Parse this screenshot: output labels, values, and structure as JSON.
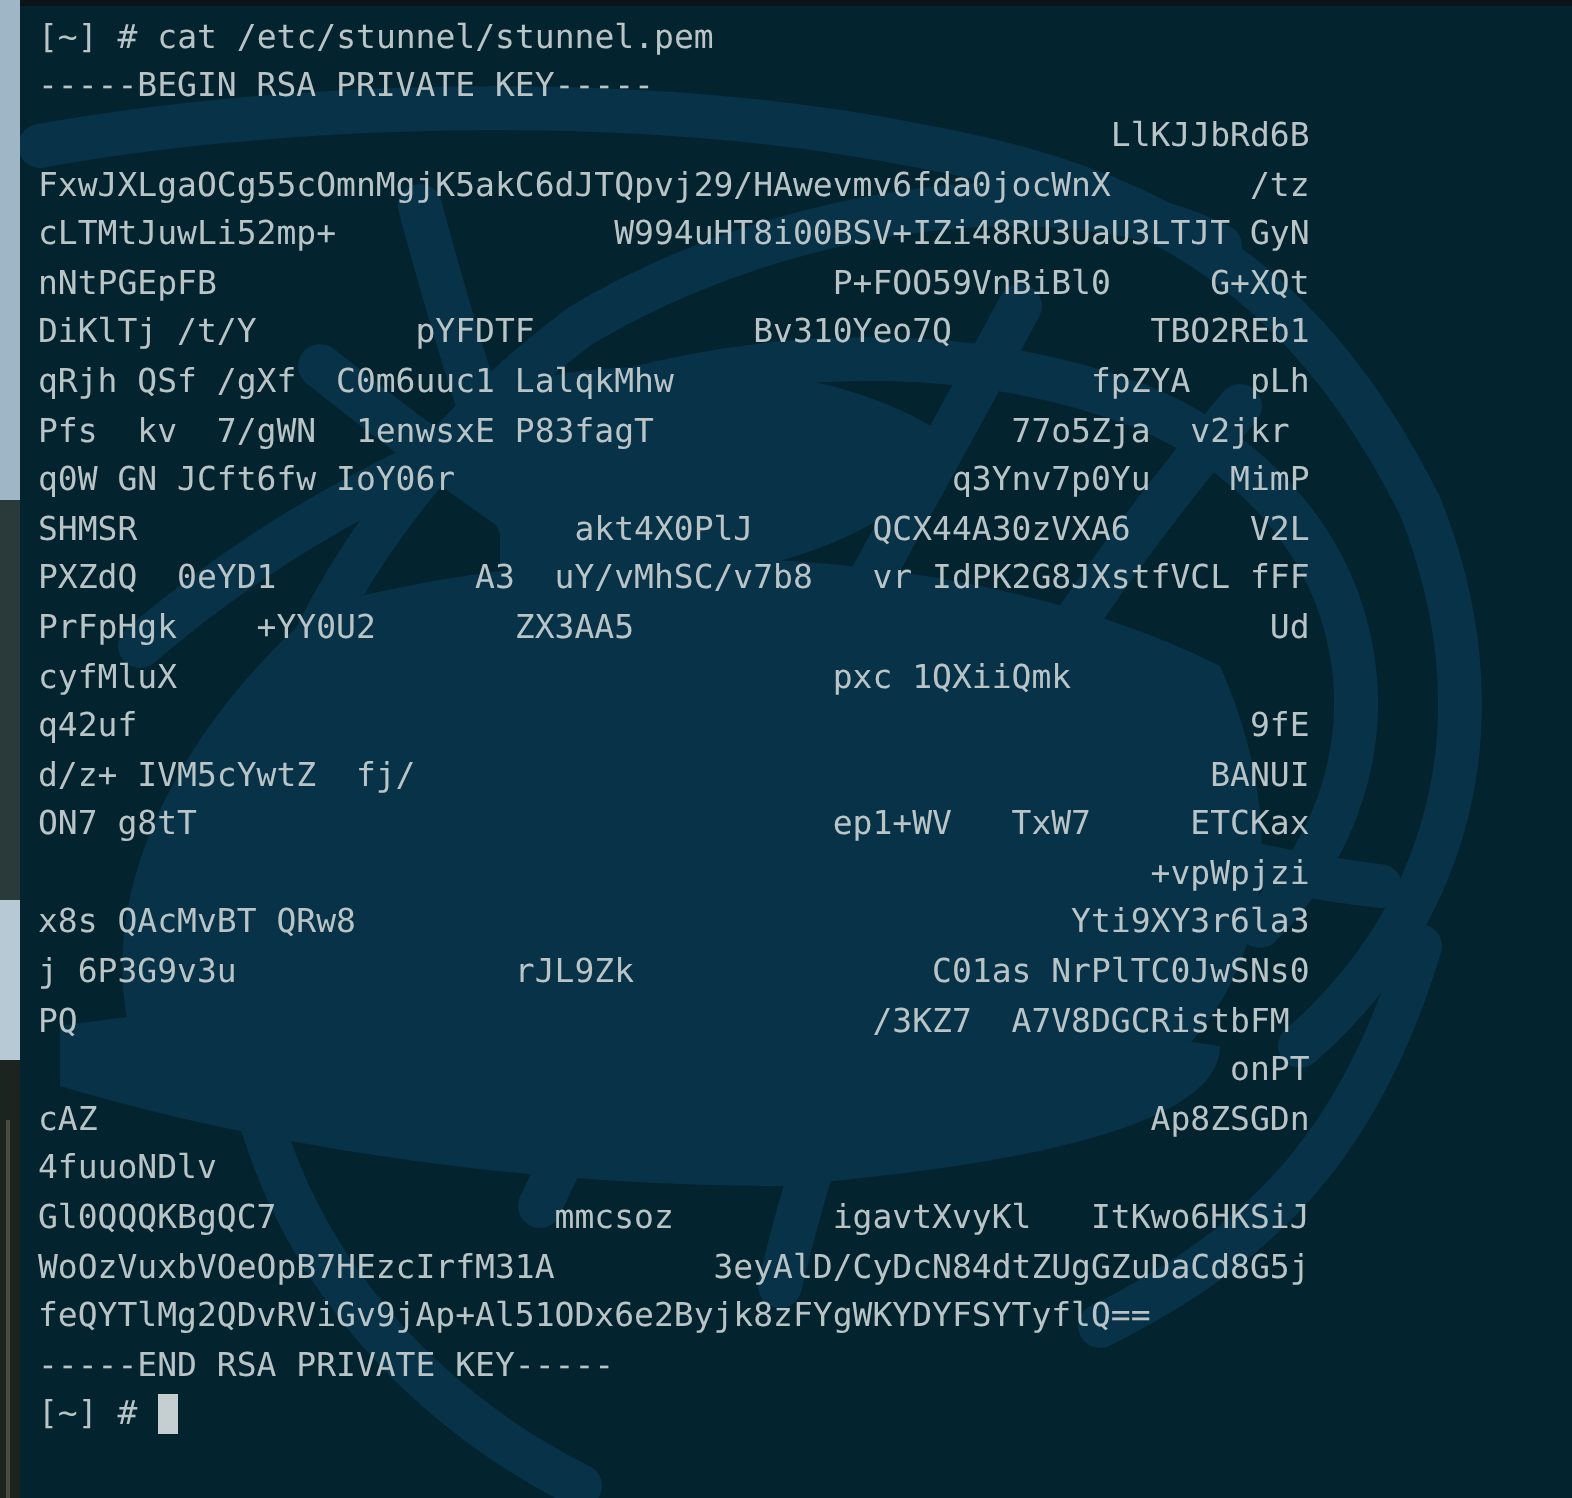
{
  "terminal": {
    "lines": [
      {
        "kind": "command",
        "prompt": "[~] #",
        "command": "cat /etc/stunnel/stunnel.pem"
      },
      {
        "kind": "output",
        "text": "-----BEGIN RSA PRIVATE KEY-----"
      },
      {
        "kind": "output",
        "text": "                                                      LlKJJbRd6B"
      },
      {
        "kind": "output",
        "text": "FxwJXLgaOCg55cOmnMgjK5akC6dJTQpvj29/HAwevmv6fda0jocWnX       /tz"
      },
      {
        "kind": "output",
        "text": "cLTMtJuwLi52mp+              W994uHT8i00BSV+IZi48RU3UaU3LTJT GyN"
      },
      {
        "kind": "output",
        "text": "nNtPGEpFB                               P+FOO59VnBiBl0     G+XQt"
      },
      {
        "kind": "output",
        "text": "DiKlTj /t/Y        pYFDTF           Bv310Yeo7Q          TBO2REb1"
      },
      {
        "kind": "output",
        "text": "qRjh QSf /gXf  C0m6uuc1 LalqkMhw                     fpZYA   pLh"
      },
      {
        "kind": "output",
        "text": "Pfs  kv  7/gWN  1enwsxE P83fagT                  77o5Zja  v2jkr"
      },
      {
        "kind": "output",
        "text": "q0W GN JCft6fw IoY06r                         q3Ynv7p0Yu    MimP"
      },
      {
        "kind": "output",
        "text": "SHMSR                      akt4X0PlJ      QCX44A30zVXA6      V2L"
      },
      {
        "kind": "output",
        "text": "PXZdQ  0eYD1          A3  uY/vMhSC/v7b8   vr IdPK2G8JXstfVCL fFF"
      },
      {
        "kind": "output",
        "text": "PrFpHgk    +YY0U2       ZX3AA5                                Ud"
      },
      {
        "kind": "output",
        "text": "cyfMluX                                 pxc 1QXiiQmk"
      },
      {
        "kind": "output",
        "text": "q42uf                                                        9fE"
      },
      {
        "kind": "output",
        "text": "d/z+ IVM5cYwtZ  fj/                                        BANUI"
      },
      {
        "kind": "output",
        "text": "ON7 g8tT                                ep1+WV   TxW7     ETCKax"
      },
      {
        "kind": "output",
        "text": "                                                        +vpWpjzi"
      },
      {
        "kind": "output",
        "text": "x8s QAcMvBT QRw8                                    Yti9XY3r6la3"
      },
      {
        "kind": "output",
        "text": "j 6P3G9v3u              rJL9Zk               C01as NrPlTC0JwSNs0"
      },
      {
        "kind": "output",
        "text": "PQ                                        /3KZ7  A7V8DGCRistbFM"
      },
      {
        "kind": "output",
        "text": "                                                            onPT"
      },
      {
        "kind": "output",
        "text": "cAZ                                                     Ap8ZSGDn"
      },
      {
        "kind": "output",
        "text": "4fuuoNDlv"
      },
      {
        "kind": "output",
        "text": "Gl0QQQKBgQC7              mmcsoz        igavtXvyKl   ItKwo6HKSiJ"
      },
      {
        "kind": "output",
        "text": "WoOzVuxbVOeOpB7HEzcIrfM31A        3eyAlD/CyDcN84dtZUgGZuDaCd8G5j"
      },
      {
        "kind": "output",
        "text": "feQYTlMg2QDvRViGv9jAp+Al51ODx6e2Byjk8zFYgWKYDYFSYTyflQ=="
      },
      {
        "kind": "output",
        "text": "-----END RSA PRIVATE KEY-----"
      },
      {
        "kind": "prompt",
        "prompt": "[~] #"
      }
    ]
  }
}
